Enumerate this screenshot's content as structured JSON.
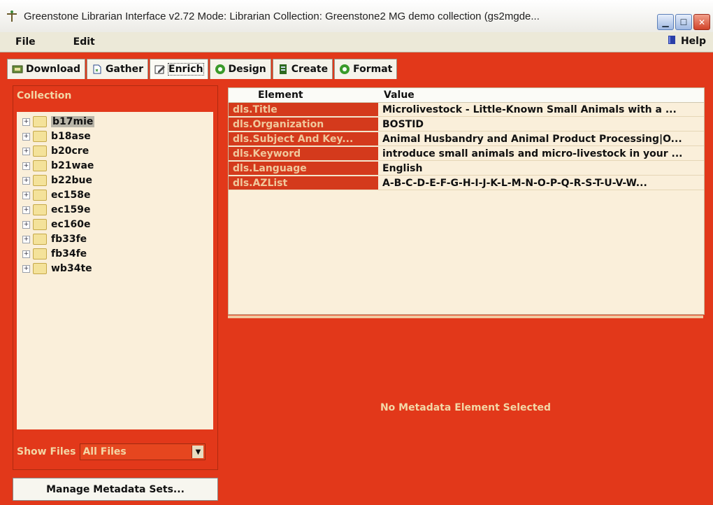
{
  "window": {
    "title": "Greenstone Librarian Interface v2.72  Mode: Librarian  Collection: Greenstone2 MG demo collection (gs2mgde...",
    "buttons": [
      "minimize",
      "maximize",
      "close"
    ]
  },
  "menu": {
    "items": [
      "File",
      "Edit"
    ],
    "help": "Help"
  },
  "tabs": [
    {
      "label": "Download",
      "icon": "download-icon"
    },
    {
      "label": "Gather",
      "icon": "gather-icon"
    },
    {
      "label": "Enrich",
      "icon": "enrich-icon",
      "active": true
    },
    {
      "label": "Design",
      "icon": "gear-icon"
    },
    {
      "label": "Create",
      "icon": "create-icon"
    },
    {
      "label": "Format",
      "icon": "gear-icon"
    }
  ],
  "left": {
    "title": "Collection",
    "tree": [
      {
        "label": "b17mie",
        "selected": true
      },
      {
        "label": "b18ase"
      },
      {
        "label": "b20cre"
      },
      {
        "label": "b21wae"
      },
      {
        "label": "b22bue"
      },
      {
        "label": "ec158e"
      },
      {
        "label": "ec159e"
      },
      {
        "label": "ec160e"
      },
      {
        "label": "fb33fe"
      },
      {
        "label": "fb34fe"
      },
      {
        "label": "wb34te"
      }
    ],
    "show_files_label": "Show Files",
    "show_files_value": "All Files",
    "manage_button": "Manage Metadata Sets..."
  },
  "table": {
    "headers": [
      "Element",
      "Value"
    ],
    "rows": [
      [
        "dls.Title",
        "Microlivestock - Little-Known Small Animals with a ..."
      ],
      [
        "dls.Organization",
        "BOSTID"
      ],
      [
        "dls.Subject And Key...",
        "Animal Husbandry and Animal Product Processing|O..."
      ],
      [
        "dls.Keyword",
        "introduce small animals and micro-livestock in your ..."
      ],
      [
        "dls.Language",
        "English"
      ],
      [
        "dls.AZList",
        "A-B-C-D-E-F-G-H-I-J-K-L-M-N-O-P-Q-R-S-T-U-V-W..."
      ]
    ]
  },
  "detail": {
    "message": "No Metadata Element Selected"
  }
}
